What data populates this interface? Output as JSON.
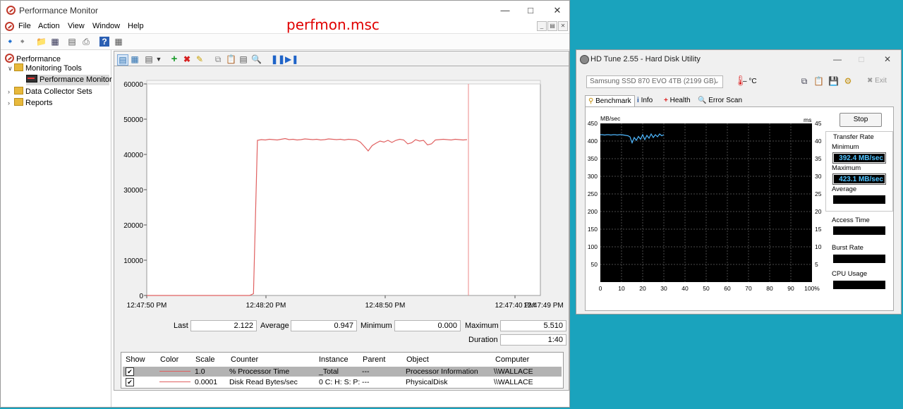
{
  "perfmon": {
    "title": "Performance Monitor",
    "menu": [
      "File",
      "Action",
      "View",
      "Window",
      "Help"
    ],
    "overlay_label": "perfmon.msc",
    "tree": {
      "root": "Performance",
      "monitoring_tools": "Monitoring Tools",
      "performance_monitor": "Performance Monitor",
      "data_collector_sets": "Data Collector Sets",
      "reports": "Reports"
    },
    "stats": {
      "last_label": "Last",
      "last_value": "2.122",
      "average_label": "Average",
      "average_value": "0.947",
      "minimum_label": "Minimum",
      "minimum_value": "0.000",
      "maximum_label": "Maximum",
      "maximum_value": "5.510",
      "duration_label": "Duration",
      "duration_value": "1:40"
    },
    "counters": {
      "headers": [
        "Show",
        "Color",
        "Scale",
        "Counter",
        "Instance",
        "Parent",
        "Object",
        "Computer"
      ],
      "rows": [
        {
          "scale": "1.0",
          "counter": "% Processor Time",
          "instance": "_Total",
          "parent": "---",
          "object": "Processor Information",
          "computer": "\\\\WALLACE"
        },
        {
          "scale": "0.0001",
          "counter": "Disk Read Bytes/sec",
          "instance": "0 C: H: S: P:",
          "parent": "---",
          "object": "PhysicalDisk",
          "computer": "\\\\WALLACE"
        }
      ]
    }
  },
  "chart_data": [
    {
      "type": "line",
      "y_tick_labels": [
        "60000",
        "50000",
        "40000",
        "30000",
        "20000",
        "10000",
        "0"
      ],
      "x_tick_labels": [
        "12:47:50 PM",
        "12:48:20 PM",
        "12:48:50 PM",
        "12:47:40 PM",
        "12:47:49 PM"
      ],
      "ylim": [
        0,
        60000
      ],
      "series": [
        {
          "color": "#e06060",
          "values": [
            0,
            0,
            0,
            0,
            0,
            0,
            0,
            0,
            0,
            0,
            0,
            0,
            0,
            0,
            0,
            0,
            0,
            0,
            0,
            0,
            0,
            0,
            0,
            0,
            0,
            0,
            0,
            500,
            44000,
            44200,
            44100,
            44300,
            44200,
            44100,
            44300,
            44500,
            44200,
            44300,
            44100,
            44200,
            44400,
            44300,
            44200,
            44300,
            44100,
            44200,
            44400,
            44300,
            44200,
            44300,
            44100,
            44300,
            44200,
            44100,
            43500,
            42300,
            41000,
            42500,
            43200,
            43800,
            43500,
            44000,
            43400,
            44000,
            44300,
            44100,
            43000,
            43300,
            44200,
            43800,
            44000,
            42700,
            43000,
            44100,
            44200,
            44300,
            44200,
            44100,
            44300,
            44200,
            44100,
            44200
          ]
        }
      ],
      "grid": false
    },
    {
      "type": "line",
      "ylabel": "MB/sec",
      "y2label": "ms",
      "ylim": [
        0,
        450
      ],
      "y2lim": [
        0,
        45
      ],
      "xlim": [
        0,
        100
      ],
      "y_tick_labels": [
        "450",
        "400",
        "350",
        "300",
        "250",
        "200",
        "150",
        "100",
        "50"
      ],
      "y2_tick_labels": [
        "45",
        "40",
        "35",
        "30",
        "25",
        "20",
        "15",
        "10",
        "5"
      ],
      "x_tick_labels": [
        "0",
        "10",
        "20",
        "30",
        "40",
        "50",
        "60",
        "70",
        "80",
        "90",
        "100%"
      ],
      "grid": true,
      "series": [
        {
          "color": "#4fb8ff",
          "x": [
            0,
            1,
            2,
            3,
            4,
            5,
            6,
            7,
            8,
            9,
            10,
            11,
            12,
            13,
            14,
            15,
            16,
            17,
            18,
            19,
            20,
            21,
            22,
            23,
            24,
            25,
            26,
            27,
            28,
            29,
            30
          ],
          "values": [
            418,
            418,
            417,
            418,
            418,
            417,
            418,
            418,
            417,
            418,
            418,
            417,
            416,
            415,
            412,
            395,
            410,
            402,
            413,
            405,
            418,
            404,
            416,
            408,
            420,
            410,
            418,
            412,
            420,
            415,
            418
          ]
        }
      ]
    }
  ],
  "hdtune": {
    "title": "HD Tune 2.55 - Hard Disk Utility",
    "drive": "Samsung SSD 870 EVO 4TB (2199 GB)",
    "temperature": "– °C",
    "exit_label": "Exit",
    "tabs": [
      "Benchmark",
      "Info",
      "Health",
      "Error Scan"
    ],
    "stop_label": "Stop",
    "transfer_rate_label": "Transfer Rate",
    "minimum_label": "Minimum",
    "minimum_value": "392.4 MB/sec",
    "maximum_label": "Maximum",
    "maximum_value": "423.1 MB/sec",
    "average_label": "Average",
    "access_time_label": "Access Time",
    "burst_rate_label": "Burst Rate",
    "cpu_usage_label": "CPU Usage",
    "y_label": "MB/sec",
    "y2_label": "ms"
  }
}
